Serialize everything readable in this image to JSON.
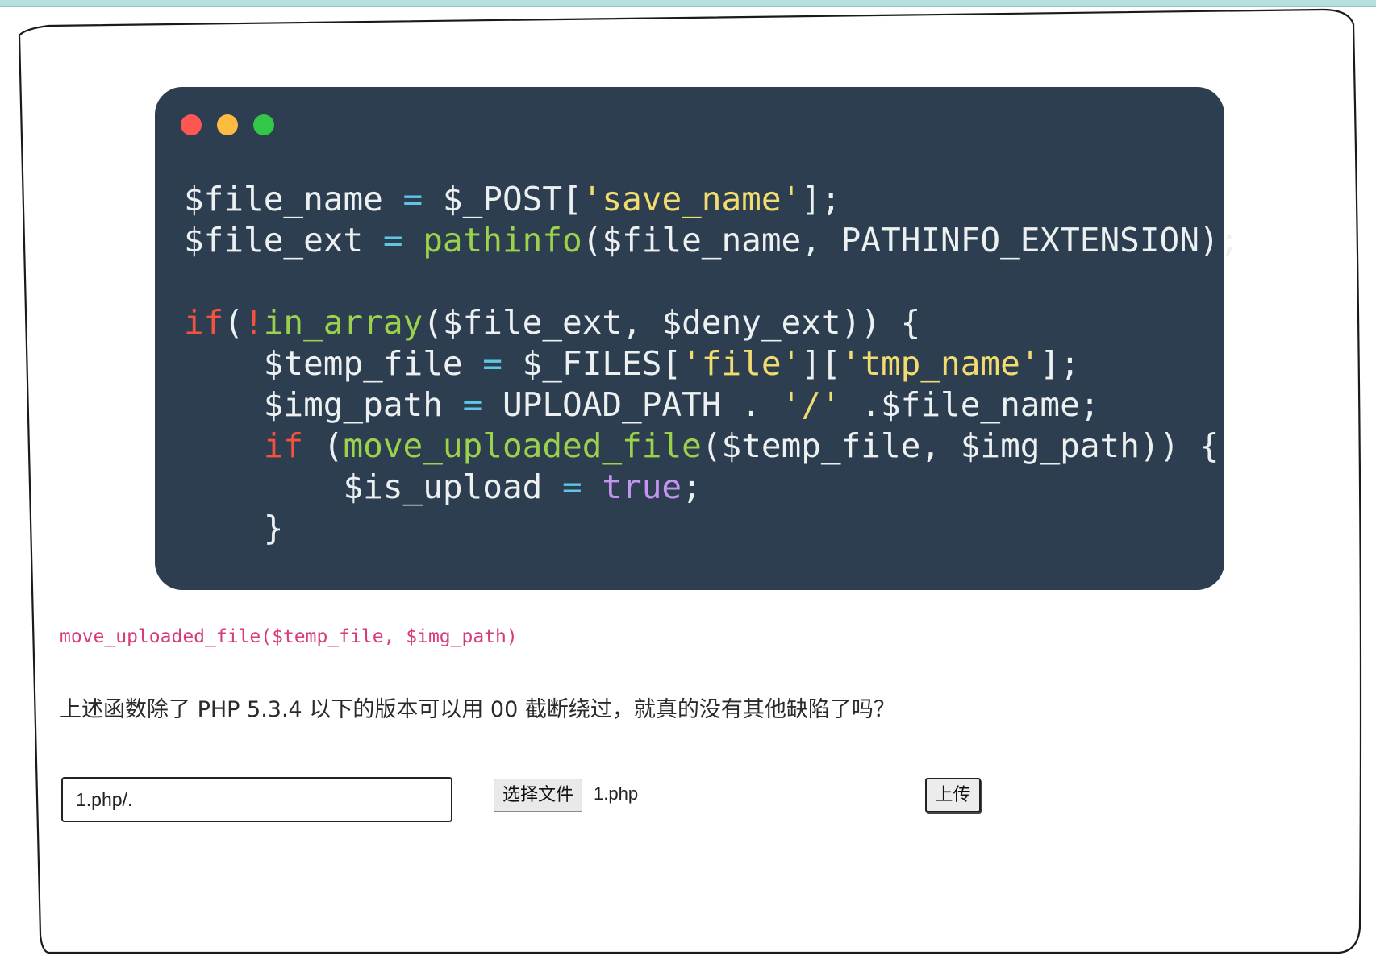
{
  "code_window": {
    "dots": [
      "red-dot",
      "yellow-dot",
      "green-dot"
    ],
    "lines": [
      [
        [
          "var",
          "$file_name "
        ],
        [
          "op",
          "="
        ],
        [
          "var",
          " $_POST["
        ],
        [
          "str",
          "'save_name'"
        ],
        [
          "var",
          "];"
        ]
      ],
      [
        [
          "var",
          "$file_ext "
        ],
        [
          "op",
          "="
        ],
        [
          "var",
          " "
        ],
        [
          "fn",
          "pathinfo"
        ],
        [
          "var",
          "($file_name, PATHINFO_EXTENSION);"
        ]
      ],
      [],
      [
        [
          "kw",
          "if"
        ],
        [
          "var",
          "("
        ],
        [
          "kw",
          "!"
        ],
        [
          "fn",
          "in_array"
        ],
        [
          "var",
          "($file_ext, $deny_ext)) {"
        ]
      ],
      [
        [
          "var",
          "    $temp_file "
        ],
        [
          "op",
          "="
        ],
        [
          "var",
          " $_FILES["
        ],
        [
          "str",
          "'file'"
        ],
        [
          "var",
          "]["
        ],
        [
          "str",
          "'tmp_name'"
        ],
        [
          "var",
          "];"
        ]
      ],
      [
        [
          "var",
          "    $img_path "
        ],
        [
          "op",
          "="
        ],
        [
          "var",
          " UPLOAD_PATH . "
        ],
        [
          "str",
          "'/'"
        ],
        [
          "var",
          " .$file_name;"
        ]
      ],
      [
        [
          "var",
          "    "
        ],
        [
          "kw",
          "if"
        ],
        [
          "var",
          " ("
        ],
        [
          "fn",
          "move_uploaded_file"
        ],
        [
          "var",
          "($temp_file, $img_path)) {"
        ]
      ],
      [
        [
          "var",
          "        $is_upload "
        ],
        [
          "op",
          "="
        ],
        [
          "var",
          " "
        ],
        [
          "const",
          "true"
        ],
        [
          "var",
          ";"
        ]
      ],
      [
        [
          "var",
          "    }"
        ]
      ]
    ]
  },
  "inline_code": "move_uploaded_file($temp_file, $img_path)",
  "question": "上述函数除了 PHP 5.3.4 以下的版本可以用 00 截断绕过，就真的没有其他缺陷了吗？",
  "form": {
    "save_name_value": "1.php/.",
    "choose_file_label": "选择文件",
    "chosen_file": "1.php",
    "upload_label": "上传"
  },
  "colors": {
    "code_bg": "#2d3e50",
    "string": "#f1dd6f",
    "function": "#9bd24b",
    "operator": "#5fc6e6",
    "keyword": "#f3523f",
    "constant": "#c594f0",
    "inline_code": "#d63b7b"
  }
}
